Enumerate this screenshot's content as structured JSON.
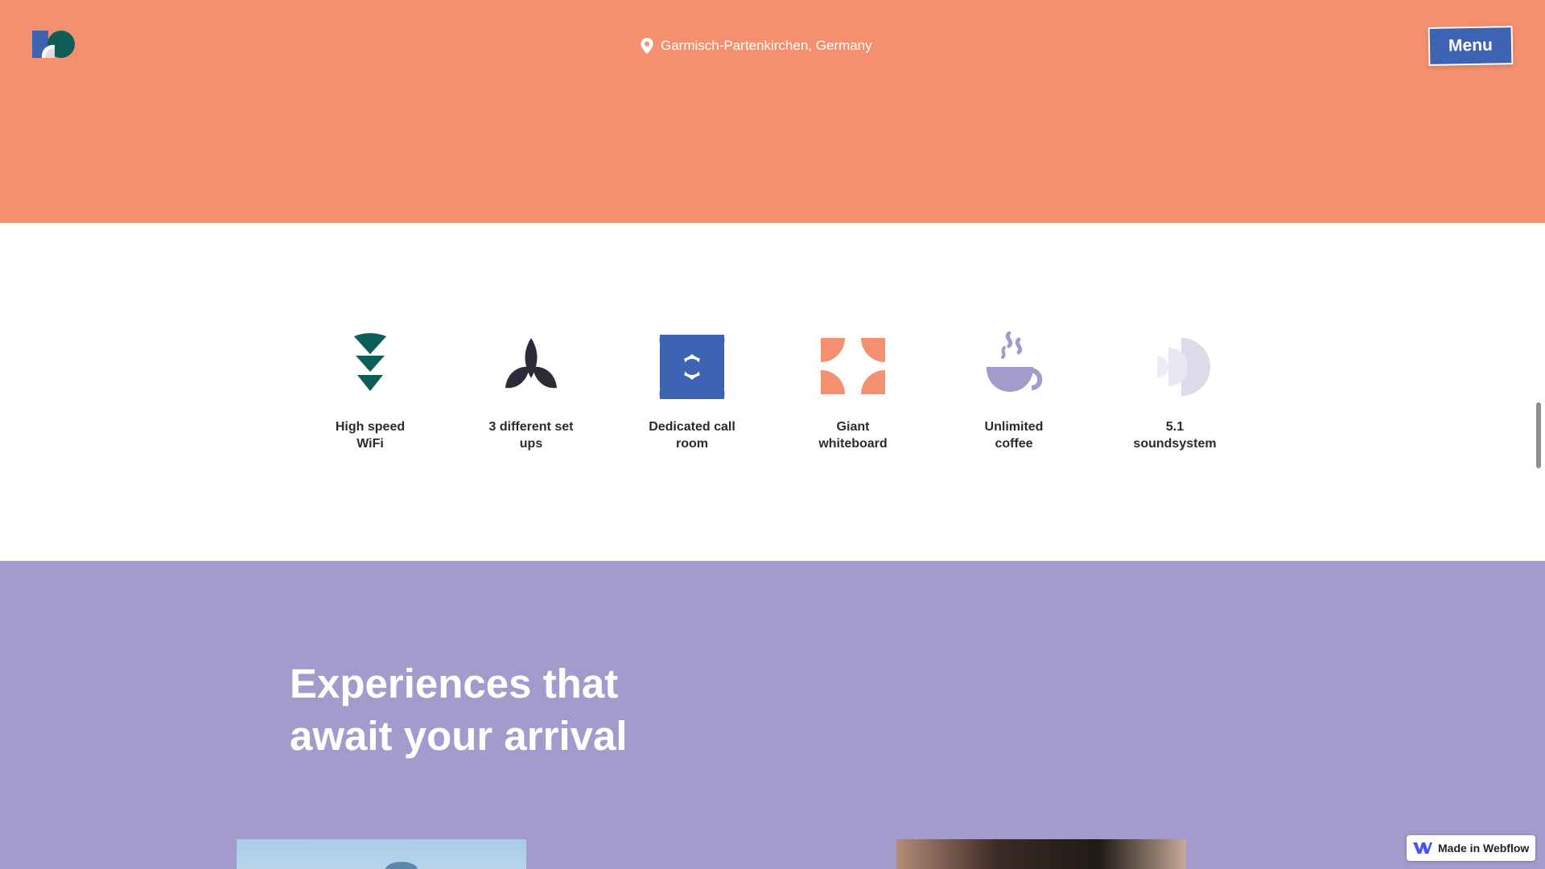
{
  "header": {
    "logo": "logo-mark",
    "location": "Garmisch-Partenkirchen, Germany",
    "menu_label": "Menu",
    "background": "#f4906f"
  },
  "amenities": {
    "items": [
      {
        "label_1": "High speed",
        "label_2": "WiFi",
        "icon": "wifi-icon",
        "color": "#0d5e56"
      },
      {
        "label_1": "3 different set",
        "label_2": "ups",
        "icon": "leaves-icon",
        "color": "#2e2a3a"
      },
      {
        "label_1": "Dedicated call",
        "label_2": "room",
        "icon": "call-room-icon",
        "color": "#3f63b3"
      },
      {
        "label_1": "Giant",
        "label_2": "whiteboard",
        "icon": "whiteboard-icon",
        "color": "#f4906f"
      },
      {
        "label_1": "Unlimited",
        "label_2": "coffee",
        "icon": "coffee-icon",
        "color": "#a39bcc"
      },
      {
        "label_1": "5.1",
        "label_2": "soundsystem",
        "icon": "sound-icon",
        "color": "#dcdaeb"
      }
    ]
  },
  "experiences": {
    "title_line_1": "Experiences that",
    "title_line_2": "await your arrival",
    "background": "#a39bcc"
  },
  "badge": {
    "label": "Made in Webflow"
  }
}
